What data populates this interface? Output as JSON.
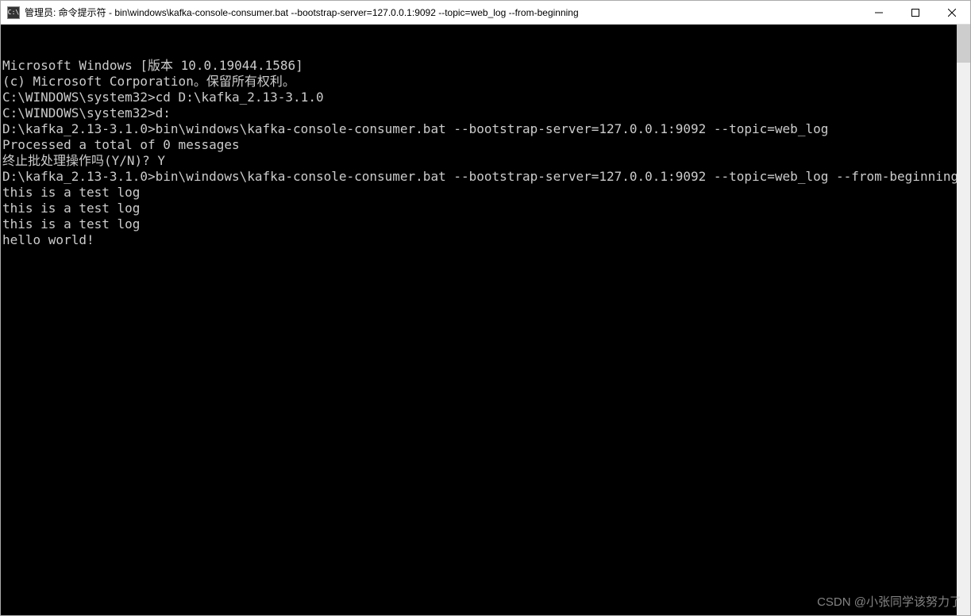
{
  "window": {
    "icon_text": "C:\\",
    "title": "管理员: 命令提示符 - bin\\windows\\kafka-console-consumer.bat --bootstrap-server=127.0.0.1:9092 --topic=web_log --from-beginning"
  },
  "terminal": {
    "lines": [
      "Microsoft Windows [版本 10.0.19044.1586]",
      "(c) Microsoft Corporation。保留所有权利。",
      "",
      "C:\\WINDOWS\\system32>cd D:\\kafka_2.13-3.1.0",
      "",
      "C:\\WINDOWS\\system32>d:",
      "",
      "D:\\kafka_2.13-3.1.0>bin\\windows\\kafka-console-consumer.bat --bootstrap-server=127.0.0.1:9092 --topic=web_log",
      "Processed a total of 0 messages",
      "终止批处理操作吗(Y/N)? Y",
      "",
      "D:\\kafka_2.13-3.1.0>bin\\windows\\kafka-console-consumer.bat --bootstrap-server=127.0.0.1:9092 --topic=web_log --from-beginning",
      "this is a test log",
      "this is a test log",
      "this is a test log",
      "hello world!"
    ]
  },
  "watermark": "CSDN @小张同学该努力了"
}
